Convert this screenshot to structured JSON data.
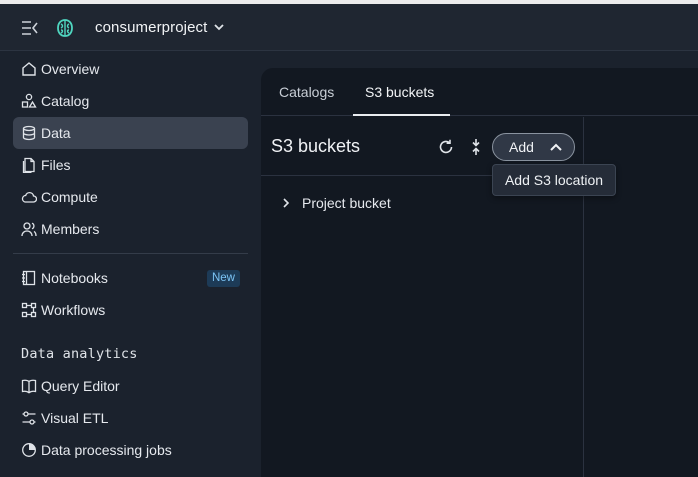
{
  "header": {
    "menu_icon": "collapse-menu-icon",
    "logo_icon": "brain-logo-icon",
    "project_name": "consumerproject",
    "project_dropdown_icon": "chevron-down-icon"
  },
  "sidebar": {
    "items": [
      {
        "label": "Overview",
        "icon": "home-icon"
      },
      {
        "label": "Catalog",
        "icon": "shapes-icon"
      },
      {
        "label": "Data",
        "icon": "database-icon",
        "active": true
      },
      {
        "label": "Files",
        "icon": "file-icon"
      },
      {
        "label": "Compute",
        "icon": "cloud-icon"
      },
      {
        "label": "Members",
        "icon": "users-icon"
      },
      {
        "label": "Notebooks",
        "icon": "notebook-icon",
        "badge": "New"
      },
      {
        "label": "Workflows",
        "icon": "workflow-icon"
      },
      {
        "label": "Query Editor",
        "icon": "book-icon"
      },
      {
        "label": "Visual ETL",
        "icon": "sliders-icon"
      },
      {
        "label": "Data processing jobs",
        "icon": "pie-icon"
      }
    ],
    "section_title": "Data analytics"
  },
  "main": {
    "tabs": [
      {
        "label": "Catalogs"
      },
      {
        "label": "S3 buckets",
        "active": true
      }
    ],
    "panel_title": "S3 buckets",
    "add_button_label": "Add",
    "tree": [
      {
        "label": "Project bucket"
      }
    ],
    "tooltip": "Add S3 location"
  },
  "colors": {
    "background": "#1b222d",
    "panel": "#121821",
    "active_item": "#3a4250",
    "badge_bg": "#1d3b57",
    "badge_text": "#7cc4f5"
  }
}
